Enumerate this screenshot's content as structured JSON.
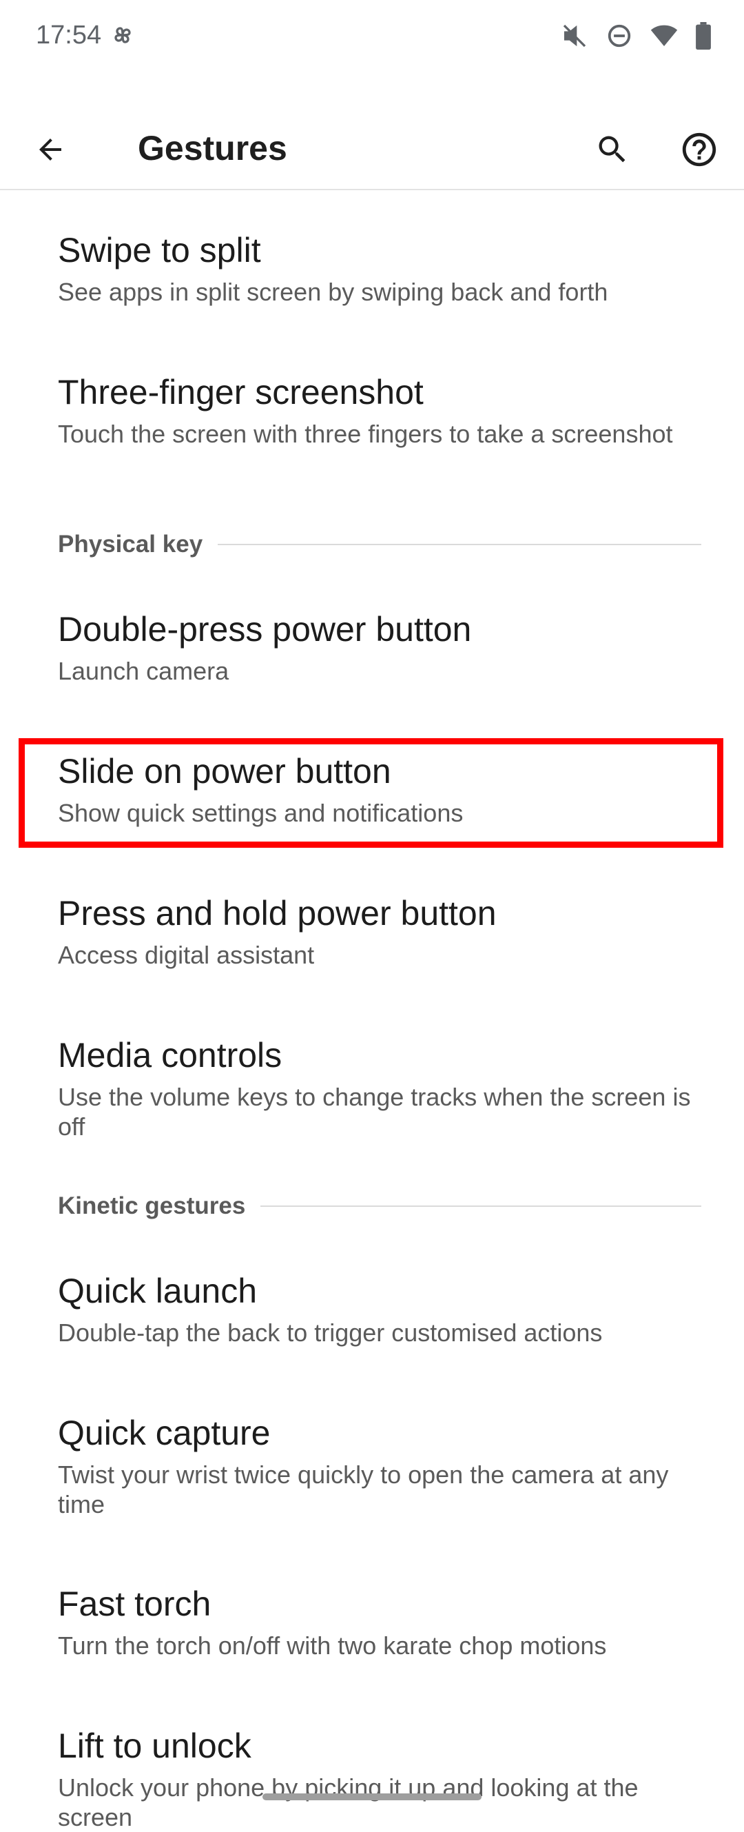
{
  "status_bar": {
    "time": "17:54",
    "icons": [
      "pinwheel-icon",
      "mute-vibrate-icon",
      "do-not-disturb-icon",
      "wifi-icon",
      "battery-icon"
    ]
  },
  "app_bar": {
    "title": "Gestures",
    "back_icon": "arrow-back-icon",
    "search_icon": "search-icon",
    "help_icon": "help-circle-icon"
  },
  "items": [
    {
      "title": "Swipe to split",
      "summary": "See apps in split screen by swiping back and forth"
    },
    {
      "title": "Three-finger screenshot",
      "summary": "Touch the screen with three fingers to take a screenshot"
    },
    {
      "title": "Double-press power button",
      "summary": "Launch camera"
    },
    {
      "title": "Slide on power button",
      "summary": "Show quick settings and notifications"
    },
    {
      "title": "Press and hold power button",
      "summary": "Access digital assistant"
    },
    {
      "title": "Media controls",
      "summary": "Use the volume keys to change tracks when the screen is off"
    },
    {
      "title": "Quick launch",
      "summary": "Double-tap the back to trigger customised actions"
    },
    {
      "title": "Quick capture",
      "summary": "Twist your wrist twice quickly to open the camera at any time"
    },
    {
      "title": "Fast torch",
      "summary": "Turn the torch on/off with two karate chop motions"
    },
    {
      "title": "Lift to unlock",
      "summary": "Unlock your phone by picking it up and looking at the screen"
    }
  ],
  "categories": {
    "physical_key": "Physical key",
    "kinetic_gestures": "Kinetic gestures"
  },
  "colors": {
    "highlight": "#ff0000",
    "divider": "#dadada"
  }
}
